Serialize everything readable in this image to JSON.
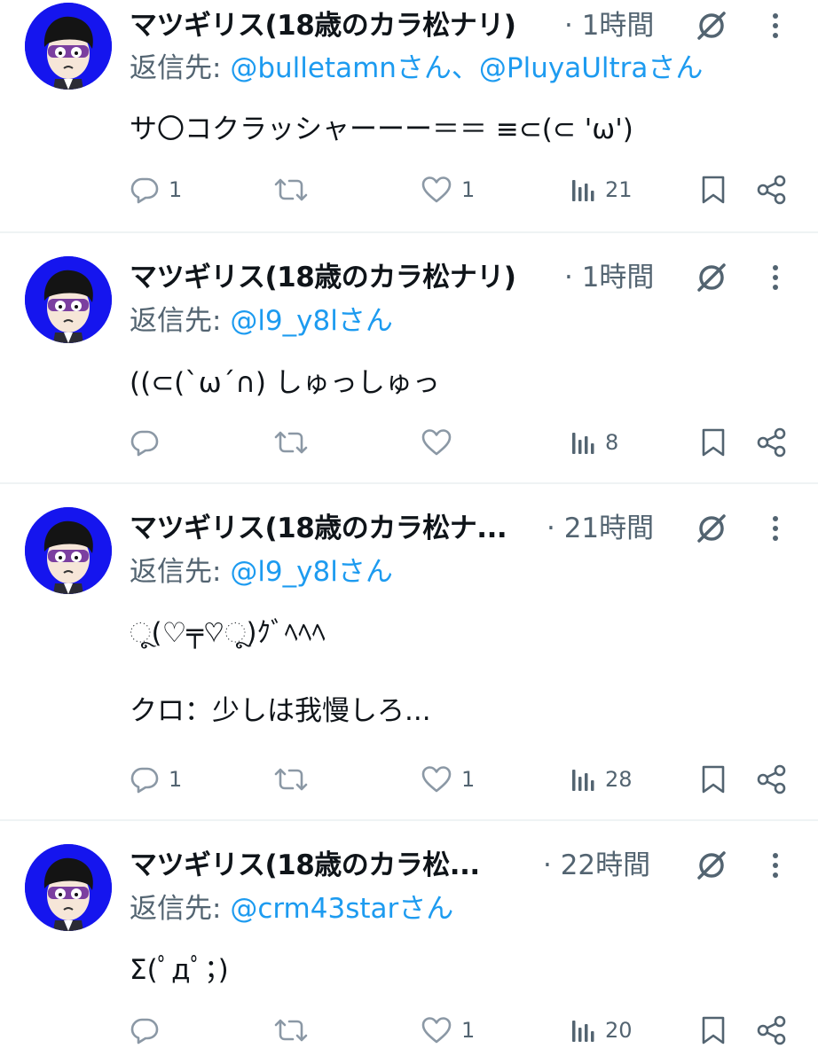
{
  "tweets": [
    {
      "author": "マツギリス(18歳のカラ松ナリ)",
      "time": "· 1時間",
      "reply_prefix": "返信先: ",
      "reply_mentions": "@bulletamnさん、@PluyaUltraさん",
      "text": "サ〇コクラッシャーーー＝＝ ≡⊂(⊂ 'ω')",
      "replies": "1",
      "retweets": "",
      "likes": "1",
      "views": "21"
    },
    {
      "author": "マツギリス(18歳のカラ松ナリ)",
      "time": "· 1時間",
      "reply_prefix": "返信先: ",
      "reply_mentions": "@l9_y8lさん",
      "text": "((⊂(`ω´∩) しゅっしゅっ",
      "replies": "",
      "retweets": "",
      "likes": "",
      "views": "8"
    },
    {
      "author": "マツギリス(18歳のカラ松ナ...",
      "time": "· 21時間",
      "reply_prefix": "返信先: ",
      "reply_mentions": "@l9_y8lさん",
      "text": "ૂ(♡╤♡ૂ)ｸﾞﾍﾍﾍ\n\nクロ：少しは我慢しろ...",
      "replies": "1",
      "retweets": "",
      "likes": "1",
      "views": "28"
    },
    {
      "author": "マツギリス(18歳のカラ松...",
      "time": "· 22時間",
      "reply_prefix": "返信先: ",
      "reply_mentions": "@crm43starさん",
      "text": "Σ(ﾟдﾟ；)",
      "replies": "",
      "retweets": "",
      "likes": "1",
      "views": "20"
    }
  ],
  "icons": {
    "reply": "reply-bubble-icon",
    "retweet": "retweet-icon",
    "like": "heart-icon",
    "views": "views-bar-chart-icon",
    "bookmark": "bookmark-icon",
    "share": "share-icon",
    "hidden": "hidden-slash-circle-icon",
    "more": "more-vertical-dots-icon"
  },
  "colors": {
    "text": "#0f1419",
    "secondary": "#536471",
    "mention": "#1d9bf0",
    "avatar_bg": "#1515ee",
    "divider": "#eff3f4"
  }
}
